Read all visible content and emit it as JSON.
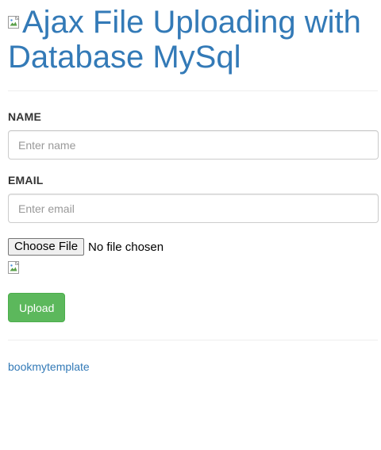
{
  "header": {
    "title": "Ajax File Uploading with Database MySql",
    "logo_icon": "broken-image-icon"
  },
  "form": {
    "name": {
      "label": "NAME",
      "placeholder": "Enter name",
      "value": ""
    },
    "email": {
      "label": "EMAIL",
      "placeholder": "Enter email",
      "value": ""
    },
    "file": {
      "button_label": "Choose File",
      "status": "No file chosen"
    },
    "preview_icon": "broken-image-icon",
    "submit_label": "Upload"
  },
  "footer": {
    "link_text": "bookmytemplate"
  },
  "colors": {
    "link": "#337ab7",
    "success": "#5cb85c",
    "divider": "#eeeeee"
  }
}
